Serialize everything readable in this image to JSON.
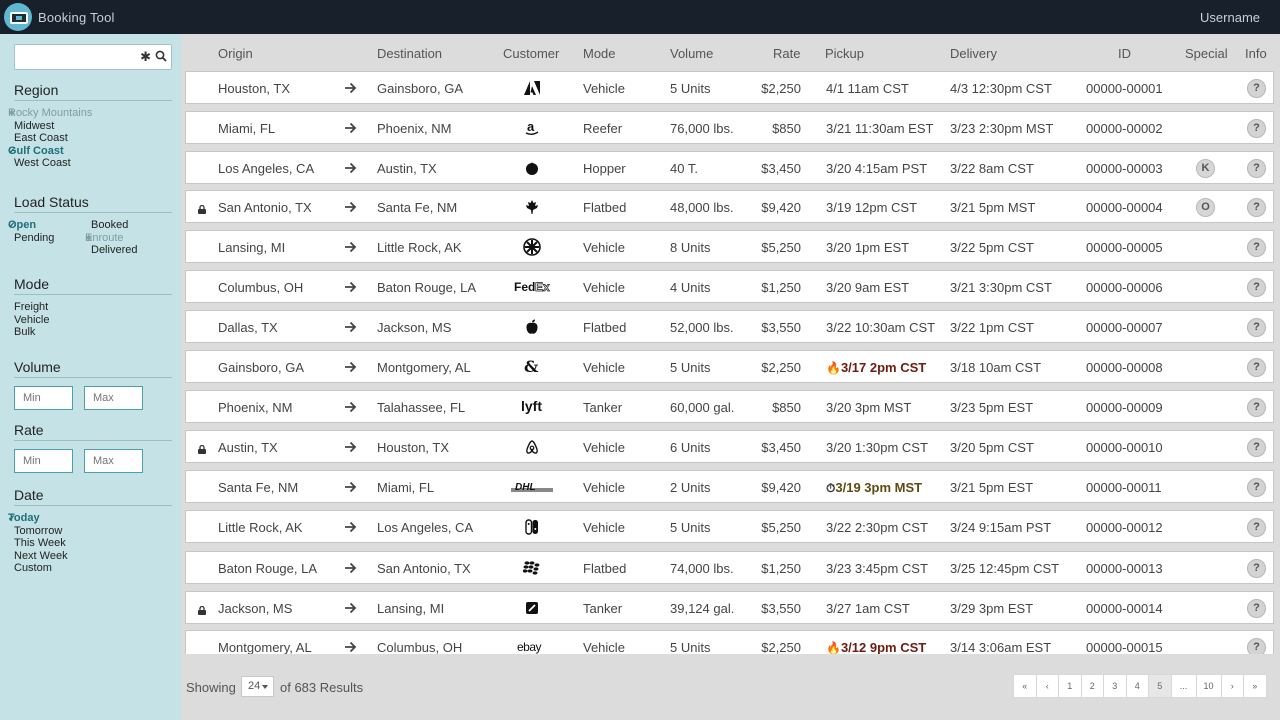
{
  "app": {
    "title": "Booking Tool",
    "username": "Username"
  },
  "search": {
    "placeholder": "",
    "clear": "✱"
  },
  "filters": {
    "region": {
      "title": "Region",
      "options": [
        {
          "label": "Rocky Mountains",
          "state": "excluded"
        },
        {
          "label": "Midwest",
          "state": "normal"
        },
        {
          "label": "East Coast",
          "state": "normal"
        },
        {
          "label": "Gulf Coast",
          "state": "selected"
        },
        {
          "label": "West Coast",
          "state": "normal"
        }
      ]
    },
    "load_status": {
      "title": "Load Status",
      "col1": [
        {
          "label": "Open",
          "state": "selected"
        },
        {
          "label": "Pending",
          "state": "normal"
        }
      ],
      "col2": [
        {
          "label": "Booked",
          "state": "normal"
        },
        {
          "label": "Enroute",
          "state": "excluded"
        },
        {
          "label": "Delivered",
          "state": "normal"
        }
      ]
    },
    "mode": {
      "title": "Mode",
      "options": [
        {
          "label": "Freight",
          "state": "normal"
        },
        {
          "label": "Vehicle",
          "state": "normal"
        },
        {
          "label": "Bulk",
          "state": "normal"
        }
      ]
    },
    "volume": {
      "title": "Volume",
      "min_placeholder": "Min",
      "max_placeholder": "Max"
    },
    "rate": {
      "title": "Rate",
      "min_placeholder": "Min",
      "max_placeholder": "Max"
    },
    "date": {
      "title": "Date",
      "options": [
        {
          "label": "Today",
          "state": "selected"
        },
        {
          "label": "Tomorrow",
          "state": "normal"
        },
        {
          "label": "This Week",
          "state": "normal"
        },
        {
          "label": "Next Week",
          "state": "normal"
        },
        {
          "label": "Custom",
          "state": "normal"
        }
      ]
    }
  },
  "table": {
    "headers": {
      "origin": "Origin",
      "destination": "Destination",
      "customer": "Customer",
      "mode": "Mode",
      "volume": "Volume",
      "rate": "Rate",
      "pickup": "Pickup",
      "delivery": "Delivery",
      "id": "ID",
      "special": "Special",
      "info": "Info"
    },
    "info_label": "?",
    "rows": [
      {
        "locked": false,
        "origin": "Houston, TX",
        "destination": "Gainsboro, GA",
        "customer_icon": "adobe-logo",
        "mode": "Vehicle",
        "volume": "5 Units",
        "rate": "$2,250",
        "pickup": "4/1 11am CST",
        "pickup_flag": "",
        "delivery": "4/3 12:30pm CST",
        "id": "00000-00001",
        "special": ""
      },
      {
        "locked": false,
        "origin": "Miami, FL",
        "destination": "Phoenix, NM",
        "customer_icon": "amazon-logo",
        "mode": "Reefer",
        "volume": "76,000 lbs.",
        "rate": "$850",
        "pickup": "3/21 11:30am EST",
        "pickup_flag": "",
        "delivery": "3/23 2:30pm MST",
        "id": "00000-00002",
        "special": ""
      },
      {
        "locked": false,
        "origin": "Los Angeles, CA",
        "destination": "Austin, TX",
        "customer_icon": "rebel-alliance-logo",
        "mode": "Hopper",
        "volume": "40 T.",
        "rate": "$3,450",
        "pickup": "3/20 4:15am PST",
        "pickup_flag": "",
        "delivery": "3/22 8am CST",
        "id": "00000-00003",
        "special": "K"
      },
      {
        "locked": true,
        "origin": "San Antonio, TX",
        "destination": "Santa Fe, NM",
        "customer_icon": "maple-leaf-logo",
        "mode": "Flatbed",
        "volume": "48,000 lbs.",
        "rate": "$9,420",
        "pickup": "3/19 12pm CST",
        "pickup_flag": "",
        "delivery": "3/21 5pm MST",
        "id": "00000-00004",
        "special": "O"
      },
      {
        "locked": false,
        "origin": "Lansing, MI",
        "destination": "Little Rock, AK",
        "customer_icon": "galactic-empire-logo",
        "mode": "Vehicle",
        "volume": "8 Units",
        "rate": "$5,250",
        "pickup": "3/20 1pm EST",
        "pickup_flag": "",
        "delivery": "3/22 5pm CST",
        "id": "00000-00005",
        "special": ""
      },
      {
        "locked": false,
        "origin": "Columbus, OH",
        "destination": "Baton Rouge, LA",
        "customer_icon": "fedex-logo",
        "mode": "Vehicle",
        "volume": "4 Units",
        "rate": "$1,250",
        "pickup": "3/20 9am EST",
        "pickup_flag": "",
        "delivery": "3/21 3:30pm CST",
        "id": "00000-00006",
        "special": ""
      },
      {
        "locked": false,
        "origin": "Dallas, TX",
        "destination": "Jackson, MS",
        "customer_icon": "apple-logo",
        "mode": "Flatbed",
        "volume": "52,000 lbs.",
        "rate": "$3,550",
        "pickup": "3/22 10:30am CST",
        "pickup_flag": "",
        "delivery": "3/22 1pm CST",
        "id": "00000-00007",
        "special": ""
      },
      {
        "locked": false,
        "origin": "Gainsboro, GA",
        "destination": "Montgomery, AL",
        "customer_icon": "ampersand-logo",
        "mode": "Vehicle",
        "volume": "5 Units",
        "rate": "$2,250",
        "pickup": "3/17 2pm CST",
        "pickup_flag": "hot",
        "delivery": "3/18 10am CST",
        "id": "00000-00008",
        "special": ""
      },
      {
        "locked": false,
        "origin": "Phoenix, NM",
        "destination": "Talahassee, FL",
        "customer_icon": "lyft-logo",
        "mode": "Tanker",
        "volume": "60,000 gal.",
        "rate": "$850",
        "pickup": "3/20 3pm MST",
        "pickup_flag": "",
        "delivery": "3/23 5pm EST",
        "id": "00000-00009",
        "special": ""
      },
      {
        "locked": true,
        "origin": "Austin, TX",
        "destination": "Houston, TX",
        "customer_icon": "airbnb-logo",
        "mode": "Vehicle",
        "volume": "6 Units",
        "rate": "$3,450",
        "pickup": "3/20 1:30pm CST",
        "pickup_flag": "",
        "delivery": "3/20 5pm CST",
        "id": "00000-00010",
        "special": ""
      },
      {
        "locked": false,
        "origin": "Santa Fe, NM",
        "destination": "Miami, FL",
        "customer_icon": "dhl-logo",
        "mode": "Vehicle",
        "volume": "2 Units",
        "rate": "$9,420",
        "pickup": "3/19 3pm MST",
        "pickup_flag": "late",
        "delivery": "3/21 5pm EST",
        "id": "00000-00011",
        "special": ""
      },
      {
        "locked": false,
        "origin": "Little Rock, AK",
        "destination": "Los Angeles, CA",
        "customer_icon": "nintendo-switch-logo",
        "mode": "Vehicle",
        "volume": "5 Units",
        "rate": "$5,250",
        "pickup": "3/22 2:30pm CST",
        "pickup_flag": "",
        "delivery": "3/24 9:15am PST",
        "id": "00000-00012",
        "special": ""
      },
      {
        "locked": false,
        "origin": "Baton Rouge, LA",
        "destination": "San Antonio, TX",
        "customer_icon": "blackberry-logo",
        "mode": "Flatbed",
        "volume": "74,000 lbs.",
        "rate": "$1,250",
        "pickup": "3/23 3:45pm CST",
        "pickup_flag": "",
        "delivery": "3/25 12:45pm CST",
        "id": "00000-00013",
        "special": ""
      },
      {
        "locked": true,
        "origin": "Jackson, MS",
        "destination": "Lansing, MI",
        "customer_icon": "squarespace-logo",
        "mode": "Tanker",
        "volume": "39,124 gal.",
        "rate": "$3,550",
        "pickup": "3/27 1am CST",
        "pickup_flag": "",
        "delivery": "3/29 3pm EST",
        "id": "00000-00014",
        "special": ""
      },
      {
        "locked": false,
        "origin": "Montgomery, AL",
        "destination": "Columbus, OH",
        "customer_icon": "ebay-logo",
        "mode": "Vehicle",
        "volume": "5 Units",
        "rate": "$2,250",
        "pickup": "3/12 9pm CST",
        "pickup_flag": "hot",
        "delivery": "3/14 3:06am EST",
        "id": "00000-00015",
        "special": ""
      }
    ]
  },
  "footer": {
    "showing_label": "Showing",
    "per_page": "24",
    "results_label": "of 683 Results",
    "pages": [
      "«",
      "‹",
      "1",
      "2",
      "3",
      "4",
      "5",
      "...",
      "10",
      "›",
      "»"
    ],
    "current_page": "5"
  }
}
